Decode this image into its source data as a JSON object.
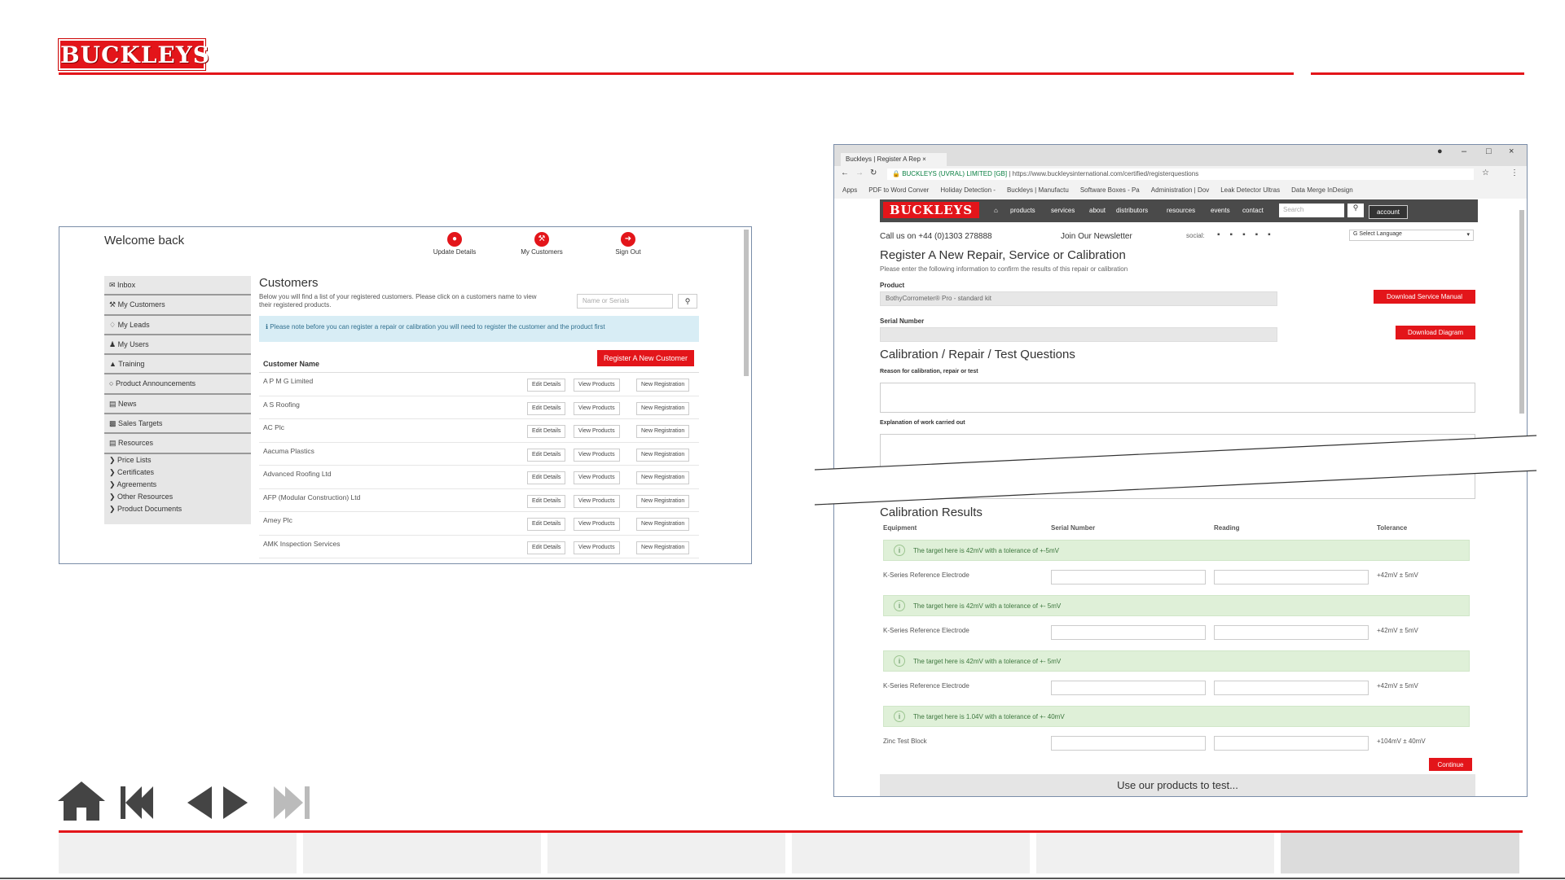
{
  "brand": {
    "logo_text": "BUCKLEYS",
    "accent": "#e3151a"
  },
  "customers_screen": {
    "welcome": "Welcome back",
    "top_nav": [
      {
        "label": "Update Details",
        "icon": "person-icon"
      },
      {
        "label": "My Customers",
        "icon": "wrench-icon"
      },
      {
        "label": "Sign Out",
        "icon": "signout-icon"
      }
    ],
    "sidebar": [
      "Inbox",
      "My Customers",
      "My Leads",
      "My Users",
      "Training",
      "Product Announcements",
      "News",
      "Sales Targets",
      "Resources"
    ],
    "sidebar_sub": [
      "Price Lists",
      "Certificates",
      "Agreements",
      "Other Resources",
      "Product Documents"
    ],
    "title": "Customers",
    "description": "Below you will find a list of your registered customers. Please click on a customers name to view their registered products.",
    "search_placeholder": "Name or Serials",
    "note": "Please note before you can register a repair or calibration you will need to register the customer and the product first",
    "column_header": "Customer Name",
    "register_button": "Register A New Customer",
    "row_buttons": {
      "edit": "Edit Details",
      "view": "View Products",
      "new": "New Registration"
    },
    "customers": [
      "A P M G Limited",
      "A S Roofing",
      "AC Plc",
      "Aacuma Plastics",
      "Advanced Roofing Ltd",
      "AFP (Modular Construction) Ltd",
      "Amey Plc",
      "AMK Inspection Services"
    ]
  },
  "repair_screen": {
    "browser": {
      "tab_title": "Buckleys | Register A Rep",
      "url_secure": "BUCKLEYS (UVRAL) LIMITED [GB]",
      "url": "https://www.buckleysinternational.com/certified/registerquestions",
      "bookmarks": [
        "Apps",
        "PDF to Word Conver",
        "Holiday Detection -",
        "Buckleys | Manufactu",
        "Software Boxes - Pa",
        "Administration | Dov",
        "Leak Detector Ultras",
        "Data Merge InDesign"
      ]
    },
    "site_nav": {
      "logo": "BUCKLEYS",
      "links": [
        "products",
        "services",
        "about",
        "distributors",
        "resources",
        "events",
        "contact"
      ],
      "search_placeholder": "Search",
      "account": "account"
    },
    "call_us": "Call us on +44 (0)1303 278888",
    "newsletter": "Join Our Newsletter",
    "social_label": "social:",
    "language": "Select Language",
    "heading": "Register A New Repair, Service or Calibration",
    "intro": "Please enter the following information to confirm the results of this repair or calibration",
    "product_label": "Product",
    "product_value": "BothyCorrometer® Pro - standard kit",
    "download_manual": "Download Service Manual",
    "serial_label": "Serial Number",
    "download_diagram": "Download Diagram",
    "questions_heading": "Calibration / Repair / Test Questions",
    "reason_label": "Reason for calibration, repair or test",
    "explanation_label": "Explanation of work carried out",
    "results_heading": "Calibration Results",
    "columns": [
      "Equipment",
      "Serial Number",
      "Reading",
      "Tolerance"
    ],
    "rows": [
      {
        "hint": "The target here is 42mV with a tolerance of +-5mV",
        "equipment": "K-Series Reference Electrode",
        "tolerance": "+42mV ± 5mV"
      },
      {
        "hint": "The target here is 42mV with a tolerance of +- 5mV",
        "equipment": "K-Series Reference Electrode",
        "tolerance": "+42mV ± 5mV"
      },
      {
        "hint": "The target here is 42mV with a tolerance of +- 5mV",
        "equipment": "K-Series Reference Electrode",
        "tolerance": "+42mV ± 5mV"
      },
      {
        "hint": "The target here is 1.04V with a tolerance of +- 40mV",
        "equipment": "Zinc Test Block",
        "tolerance": "+104mV ± 40mV"
      }
    ],
    "continue": "Continue",
    "footer_banner": "Use our products to test..."
  },
  "nav_controls": [
    "home-icon",
    "first-icon",
    "prev-icon",
    "next-icon",
    "last-icon"
  ]
}
